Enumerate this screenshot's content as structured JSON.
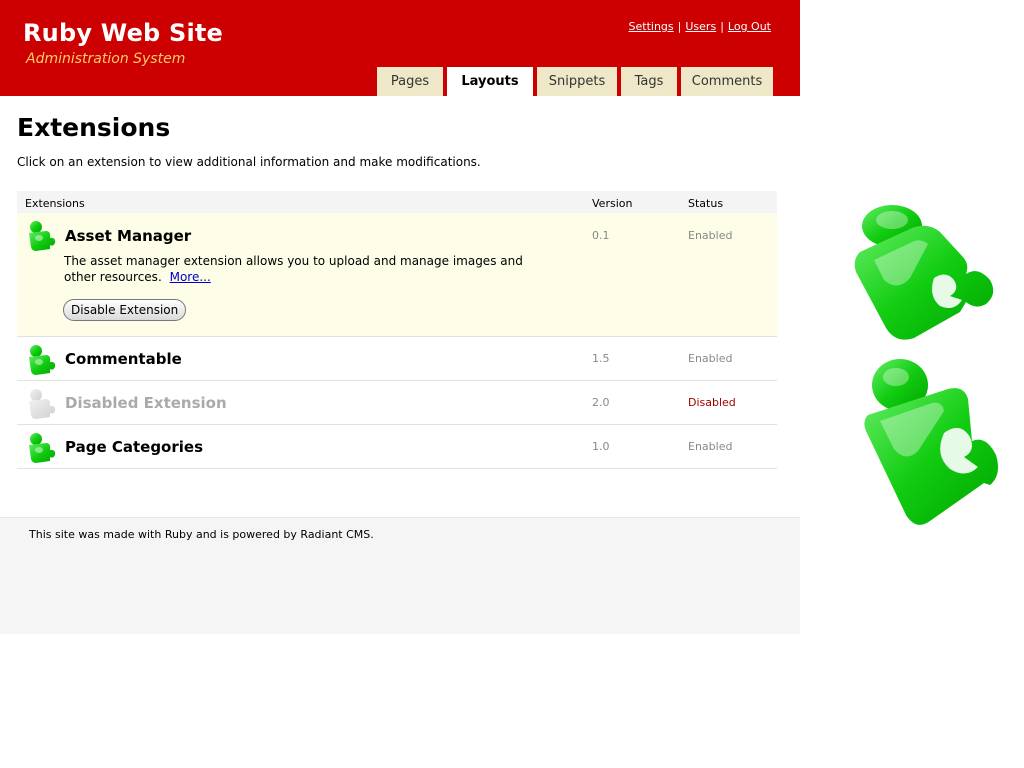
{
  "header": {
    "title": "Ruby Web Site",
    "subtitle": "Administration System",
    "links": {
      "settings": "Settings",
      "users": "Users",
      "logout": "Log Out"
    },
    "separator": "|",
    "tabs": [
      {
        "label": "Pages",
        "active": false
      },
      {
        "label": "Layouts",
        "active": true
      },
      {
        "label": "Snippets",
        "active": false
      },
      {
        "label": "Tags",
        "active": false
      },
      {
        "label": "Comments",
        "active": false
      }
    ]
  },
  "main": {
    "title": "Extensions",
    "intro": "Click on an extension to view additional information and make modifications.",
    "table": {
      "headers": {
        "name": "Extensions",
        "version": "Version",
        "status": "Status"
      },
      "rows": [
        {
          "name": "Asset Manager",
          "version": "0.1",
          "status": "Enabled",
          "description": "The asset manager extension allows you to upload and manage images and other resources.",
          "more_link": "More...",
          "button": "Disable Extension"
        },
        {
          "name": "Commentable",
          "version": "1.5",
          "status": "Enabled"
        },
        {
          "name": "Disabled Extension",
          "version": "2.0",
          "status": "Disabled"
        },
        {
          "name": "Page Categories",
          "version": "1.0",
          "status": "Enabled"
        }
      ]
    }
  },
  "footer": {
    "text": "This site was made with Ruby and is powered by Radiant CMS."
  },
  "icons": {
    "extension": "puzzle-piece-icon",
    "disabled_extension": "puzzle-piece-disabled-icon"
  },
  "colors": {
    "brand_red": "#cc0000",
    "subtitle_orange": "#ffcc66",
    "tab_bg": "#efe8c8",
    "puzzle_green": "#22cc22",
    "disabled_red": "#990000"
  }
}
